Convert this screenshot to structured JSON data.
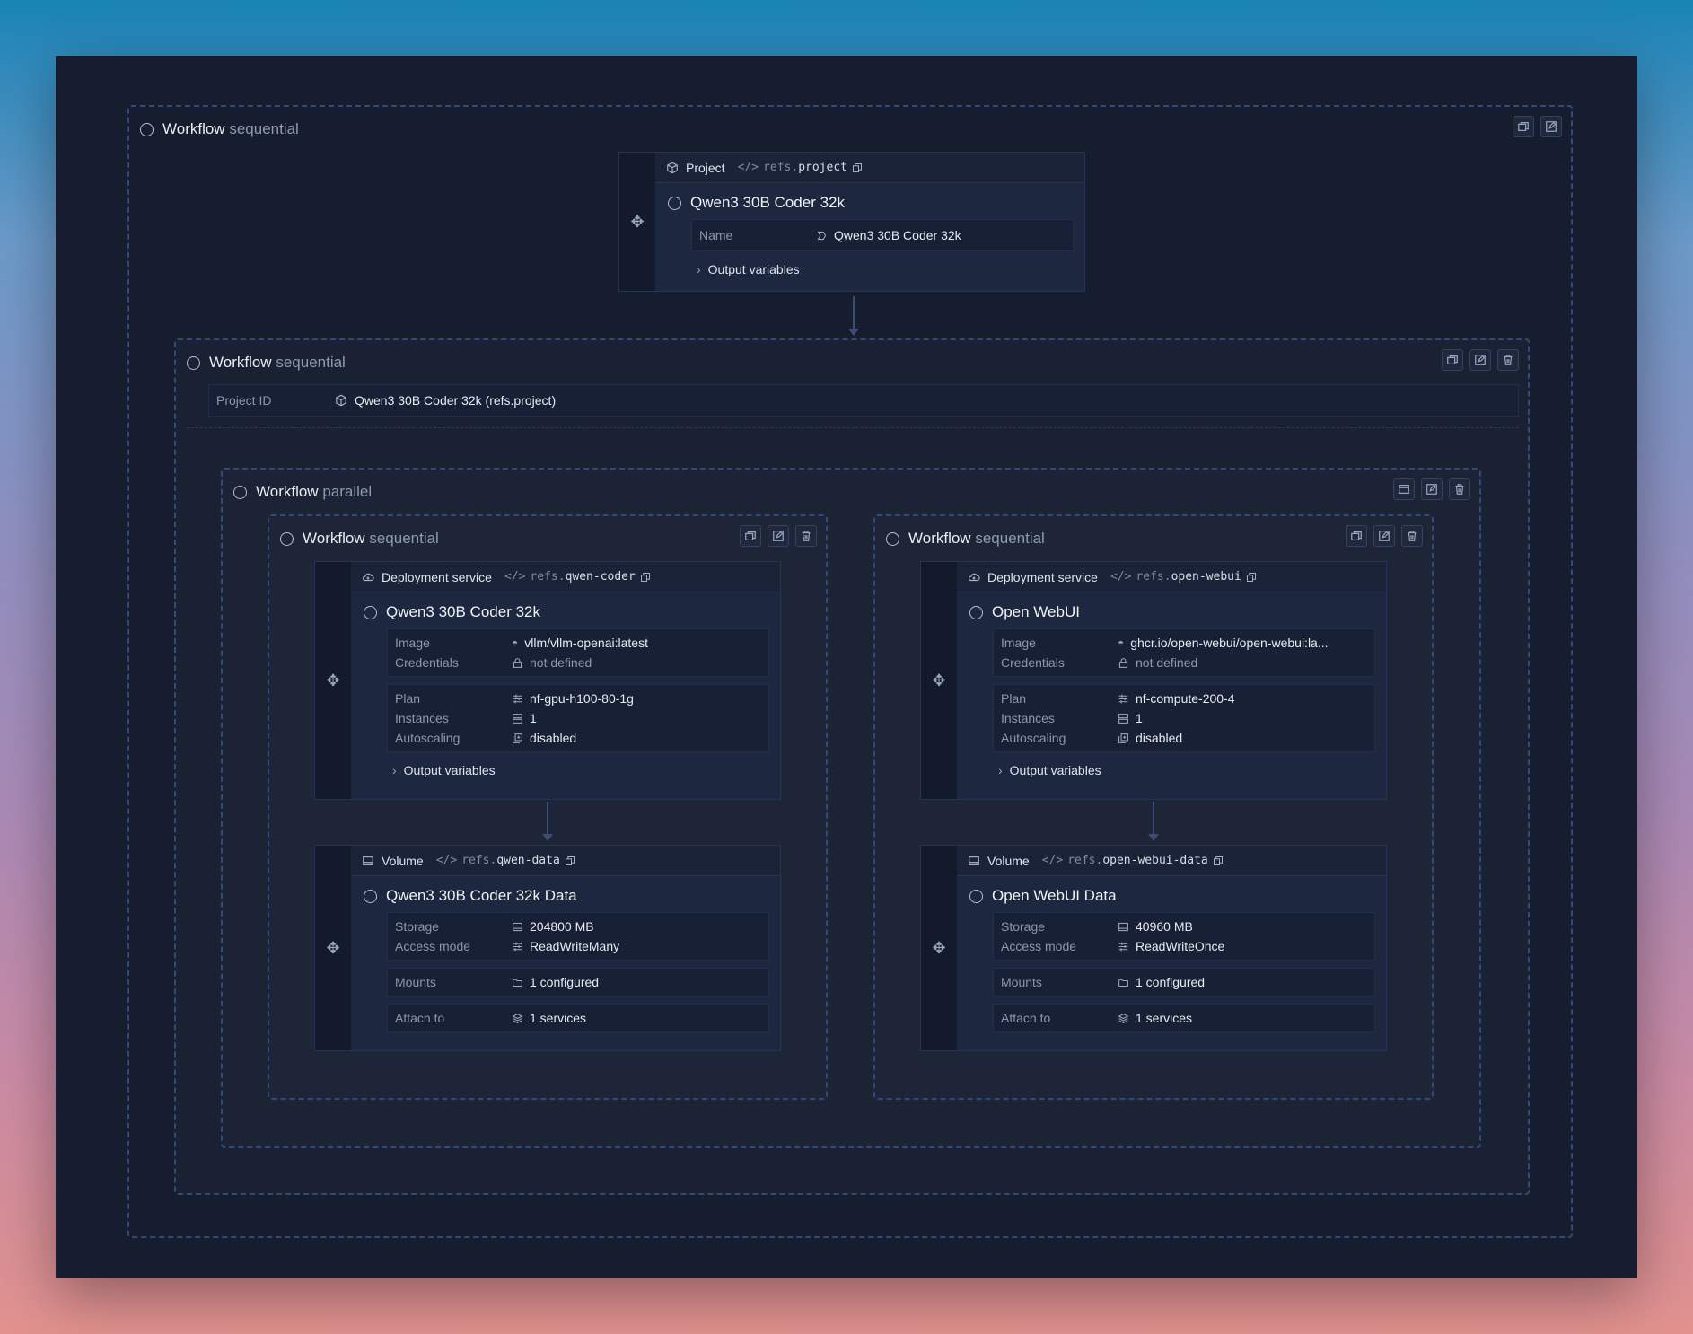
{
  "workflows": {
    "outer": {
      "label": "Workflow",
      "mode": "sequential"
    },
    "second": {
      "label": "Workflow",
      "mode": "sequential",
      "project_id_label": "Project ID",
      "project_id_value": "Qwen3 30B Coder 32k (refs.project)"
    },
    "parallel": {
      "label": "Workflow",
      "mode": "parallel"
    },
    "left": {
      "label": "Workflow",
      "mode": "sequential"
    },
    "right": {
      "label": "Workflow",
      "mode": "sequential"
    }
  },
  "project_card": {
    "type": "Project",
    "ref_prefix": "refs.",
    "ref_name": "project",
    "title": "Qwen3 30B Coder 32k",
    "name_label": "Name",
    "name_value": "Qwen3 30B Coder 32k",
    "output_variables": "Output variables"
  },
  "service_left": {
    "type": "Deployment service",
    "ref_prefix": "refs.",
    "ref_name": "qwen-coder",
    "title": "Qwen3 30B Coder 32k",
    "image_label": "Image",
    "image_value": "vllm/vllm-openai:latest",
    "credentials_label": "Credentials",
    "credentials_value": "not defined",
    "plan_label": "Plan",
    "plan_value": "nf-gpu-h100-80-1g",
    "instances_label": "Instances",
    "instances_value": "1",
    "autoscaling_label": "Autoscaling",
    "autoscaling_value": "disabled",
    "output_variables": "Output variables"
  },
  "service_right": {
    "type": "Deployment service",
    "ref_prefix": "refs.",
    "ref_name": "open-webui",
    "title": "Open WebUI",
    "image_label": "Image",
    "image_value": "ghcr.io/open-webui/open-webui:la...",
    "credentials_label": "Credentials",
    "credentials_value": "not defined",
    "plan_label": "Plan",
    "plan_value": "nf-compute-200-4",
    "instances_label": "Instances",
    "instances_value": "1",
    "autoscaling_label": "Autoscaling",
    "autoscaling_value": "disabled",
    "output_variables": "Output variables"
  },
  "volume_left": {
    "type": "Volume",
    "ref_prefix": "refs.",
    "ref_name": "qwen-data",
    "title": "Qwen3 30B Coder 32k Data",
    "storage_label": "Storage",
    "storage_value": "204800 MB",
    "access_label": "Access mode",
    "access_value": "ReadWriteMany",
    "mounts_label": "Mounts",
    "mounts_value": "1 configured",
    "attach_label": "Attach to",
    "attach_value": "1 services"
  },
  "volume_right": {
    "type": "Volume",
    "ref_prefix": "refs.",
    "ref_name": "open-webui-data",
    "title": "Open WebUI Data",
    "storage_label": "Storage",
    "storage_value": "40960 MB",
    "access_label": "Access mode",
    "access_value": "ReadWriteOnce",
    "mounts_label": "Mounts",
    "mounts_value": "1 configured",
    "attach_label": "Attach to",
    "attach_value": "1 services"
  },
  "icons": {
    "workflow_status": "circle-icon",
    "collapse": "window-icon",
    "edit": "edit-icon",
    "delete": "trash-icon",
    "drag": "move-icon",
    "project": "cube-icon",
    "service": "cloud-icon",
    "volume": "disk-icon",
    "ref": "code-icon",
    "copy": "copy-icon"
  }
}
